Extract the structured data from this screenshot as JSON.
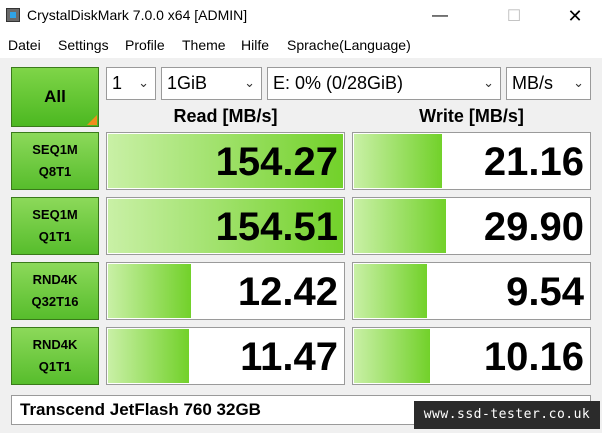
{
  "window": {
    "title": "CrystalDiskMark 7.0.0 x64 [ADMIN]",
    "controls": {
      "minimize": "—",
      "maximize": "☐",
      "close": "✕"
    }
  },
  "menu": [
    "Datei",
    "Settings",
    "Profile",
    "Theme",
    "Hilfe",
    "Sprache(Language)"
  ],
  "toolbar": {
    "all_label": "All",
    "count": "1",
    "size": "1GiB",
    "drive": "E: 0% (0/28GiB)",
    "unit": "MB/s"
  },
  "headers": {
    "read": "Read [MB/s]",
    "write": "Write [MB/s]"
  },
  "rows": [
    {
      "line1": "SEQ1M",
      "line2": "Q8T1",
      "read": "154.27",
      "write": "21.16",
      "read_fill": 0.99,
      "write_fill": 0.37
    },
    {
      "line1": "SEQ1M",
      "line2": "Q1T1",
      "read": "154.51",
      "write": "29.90",
      "read_fill": 0.99,
      "write_fill": 0.39
    },
    {
      "line1": "RND4K",
      "line2": "Q32T16",
      "read": "12.42",
      "write": "9.54",
      "read_fill": 0.35,
      "write_fill": 0.31
    },
    {
      "line1": "RND4K",
      "line2": "Q1T1",
      "read": "11.47",
      "write": "10.16",
      "read_fill": 0.34,
      "write_fill": 0.32
    }
  ],
  "comment": "Transcend JetFlash 760 32GB",
  "watermark": "www.ssd-tester.co.uk",
  "colors": {
    "accent": "#57bd2c",
    "bar_start": "#c9f0a6",
    "bar_end": "#72d12a",
    "corner": "#f08c1a"
  }
}
